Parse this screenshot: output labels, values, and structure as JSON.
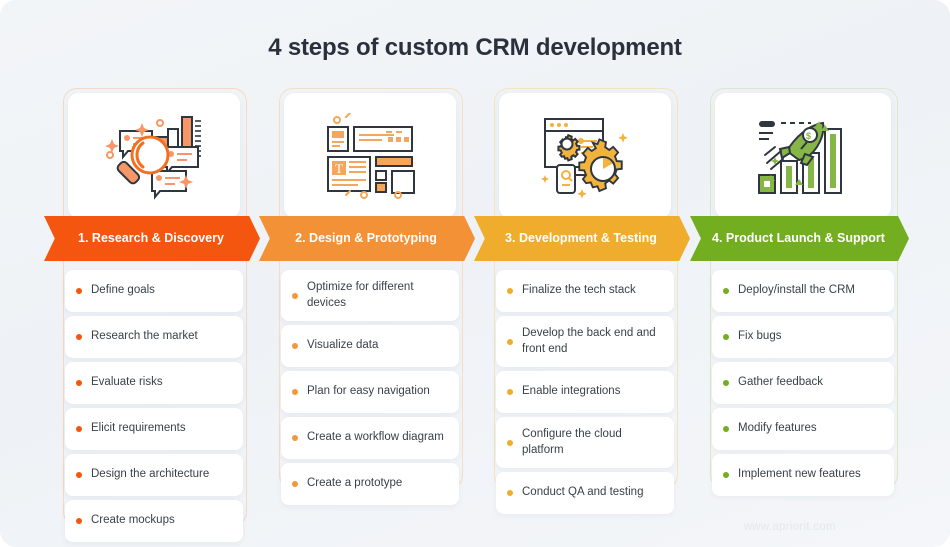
{
  "page": {
    "title": "4 steps of custom CRM development",
    "watermark": "www.apriorit.com",
    "background_color": "#f1f4f7",
    "title_color": "#2b313c"
  },
  "steps": [
    {
      "number": "1",
      "banner_label": "1. Research & Discovery",
      "color": "#f4560f",
      "icon": "magnifier-chart-icon",
      "items": [
        "Define goals",
        "Research the market",
        "Evaluate risks",
        "Elicit requirements",
        "Design the architecture",
        "Create mockups"
      ]
    },
    {
      "number": "2",
      "banner_label": "2. Design & Prototyping",
      "color": "#f39137",
      "icon": "wireframe-layout-icon",
      "items": [
        "Optimize for different devices",
        "Visualize data",
        "Plan for easy navigation",
        "Create a workflow diagram",
        "Create a prototype"
      ]
    },
    {
      "number": "3",
      "banner_label": "3. Development & Testing",
      "color": "#f0ac2c",
      "icon": "gears-browser-icon",
      "items": [
        "Finalize the tech stack",
        "Develop the back end and front end",
        "Enable integrations",
        "Configure the cloud platform",
        "Conduct QA and testing"
      ]
    },
    {
      "number": "4",
      "banner_label": "4. Product Launch & Support",
      "color": "#73ae21",
      "icon": "rocket-growth-icon",
      "items": [
        "Deploy/install the CRM",
        "Fix bugs",
        "Gather feedback",
        "Modify features",
        "Implement new features"
      ]
    }
  ]
}
